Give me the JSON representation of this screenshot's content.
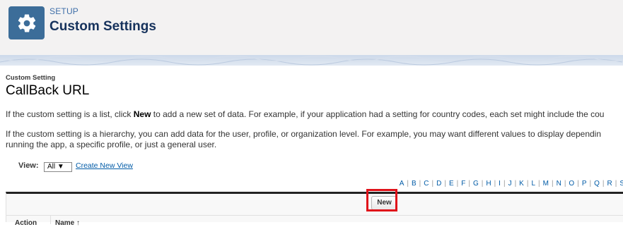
{
  "header": {
    "section_label": "SETUP",
    "title": "Custom Settings",
    "icon": "gear-icon"
  },
  "record": {
    "type_label": "Custom Setting",
    "title": "CallBack URL"
  },
  "description": {
    "para1_pre": "If the custom setting is a list, click ",
    "para1_bold": "New",
    "para1_post": " to add a new set of data. For example, if your application had a setting for country codes, each set might include the cou",
    "para2_line1": "If the custom setting is a hierarchy, you can add data for the user, profile, or organization level. For example, you may want different values to display dependin",
    "para2_line2": "running the app, a specific profile, or just a general user."
  },
  "view": {
    "label": "View:",
    "selected": "All ▼",
    "create_link": "Create New View"
  },
  "alphabet": [
    "A",
    "B",
    "C",
    "D",
    "E",
    "F",
    "G",
    "H",
    "I",
    "J",
    "K",
    "L",
    "M",
    "N",
    "O",
    "P",
    "Q",
    "R",
    "S"
  ],
  "list": {
    "new_button": "New",
    "columns": [
      "Action",
      "Name ↑"
    ]
  },
  "colors": {
    "brand_tile": "#3c6d99",
    "title": "#16325c",
    "link": "#015ba7",
    "highlight": "#e0111a"
  }
}
